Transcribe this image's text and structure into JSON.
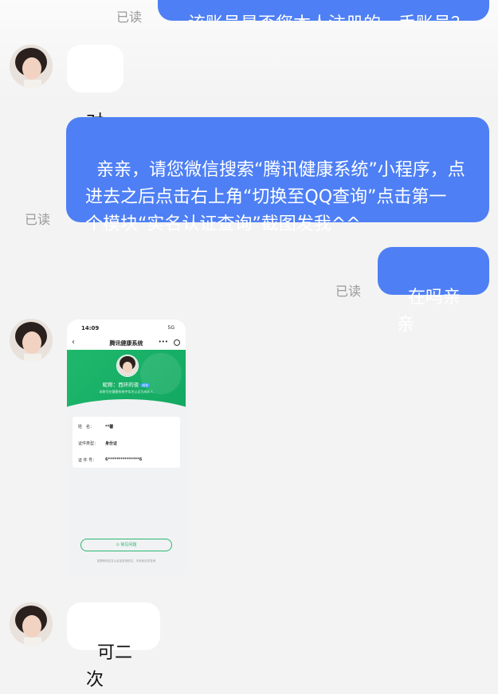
{
  "messages": {
    "top_partial_text": "该账号是否您本人注册的一手账号？",
    "top_read": "已读",
    "msg1_text": "对",
    "msg2_text": "亲亲，请您微信搜索“腾讯健康系统”小程序，点\n进去之后点击右上角“切换至QQ查询”点击第一\n个模块“实名认证查询”截图发我^^",
    "msg2_read": "已读",
    "msg3_text": "在吗亲亲",
    "msg3_read": "已读",
    "msg5_text": "可二次"
  },
  "screenshot": {
    "time": "14:09",
    "signal": "5G",
    "title": "腾讯健康系统",
    "back": "‹",
    "more": "•••",
    "nickname": "昵称：西环的夜",
    "tag": "成年",
    "subtitle": "本账号在健康系统中实名认证为成年人",
    "rows": [
      {
        "label": "姓　名：",
        "value": "**馨"
      },
      {
        "label": "证件类型：",
        "value": "身份证"
      },
      {
        "label": "证 件 号：",
        "value": "6***************6"
      }
    ],
    "faq": "⊙ 常见问题",
    "footer": "如需修改实名认证信息请前往，本系统仅供查询"
  },
  "colors": {
    "page_bg": "#f3f3f3",
    "bubble_out": "#4e7ff4",
    "bubble_in": "#ffffff",
    "read": "#9a9a9a",
    "green": "#1fb86b"
  }
}
